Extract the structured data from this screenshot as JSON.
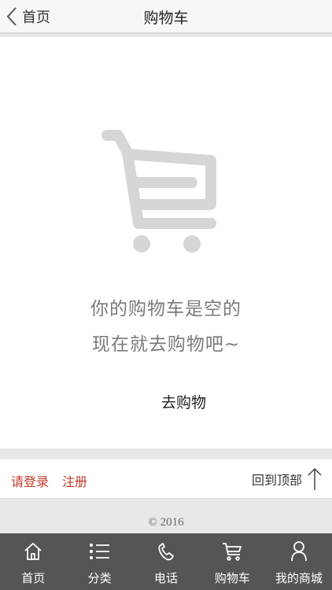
{
  "header": {
    "back_label": "首页",
    "title": "购物车"
  },
  "empty": {
    "line1": "你的购物车是空的",
    "line2": "现在就去购物吧~",
    "action_label": "去购物"
  },
  "footer_links": {
    "login": "请登录",
    "register": "注册",
    "back_to_top": "回到顶部"
  },
  "copyright": "© 2016",
  "tabbar": [
    {
      "label": "首页",
      "icon": "home-icon"
    },
    {
      "label": "分类",
      "icon": "list-icon"
    },
    {
      "label": "电话",
      "icon": "phone-icon"
    },
    {
      "label": "购物车",
      "icon": "cart-icon"
    },
    {
      "label": "我的商城",
      "icon": "user-icon"
    }
  ],
  "colors": {
    "accent_red": "#c0392b",
    "tabbar_bg": "#555555",
    "header_bg": "#f7f7f7"
  }
}
